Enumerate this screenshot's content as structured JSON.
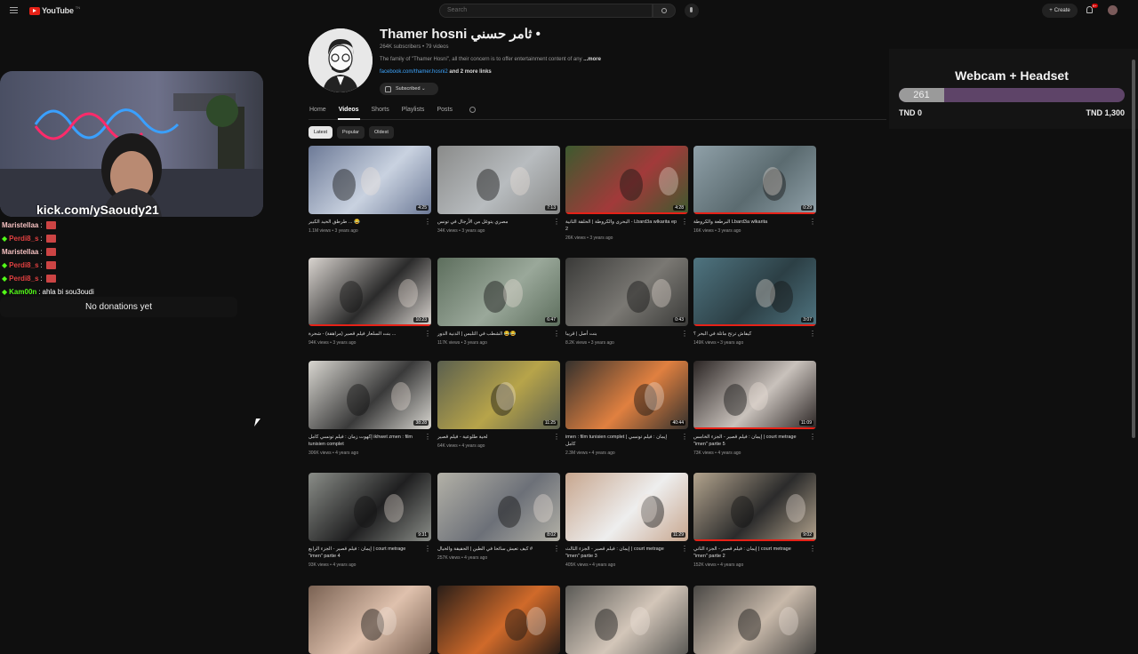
{
  "app": {
    "logo_text": "YouTube",
    "logo_sup": "TN"
  },
  "topbar": {
    "search_placeholder": "Search",
    "create_label": "Create",
    "notif_count": "9+"
  },
  "channel": {
    "name": "Thamer hosni ثامر حسني •",
    "meta": "264K subscribers • 79 videos",
    "desc": "The family of \"Thamer Hosni\", all their concern is to offer entertainment content of any",
    "more": "...more",
    "link": "facebook.com/thamer.hosni2",
    "more_links": "and 2 more links",
    "subscribed": "Subscribed"
  },
  "tabs": [
    {
      "label": "Home"
    },
    {
      "label": "Videos"
    },
    {
      "label": "Shorts"
    },
    {
      "label": "Playlists"
    },
    {
      "label": "Posts"
    }
  ],
  "chips": [
    {
      "label": "Latest"
    },
    {
      "label": "Popular"
    },
    {
      "label": "Oldest"
    }
  ],
  "videos": [
    {
      "title": "طرطق الحيد الكبير ... 😂 ",
      "meta": "1.1M views • 3 years ago",
      "duration": "4:25",
      "progress": 0.0
    },
    {
      "title": "مصري يتوغل من الأرجال في تونس",
      "meta": "34K views • 3 years ago",
      "duration": "7:13",
      "progress": 0.0
    },
    {
      "title": "البحرى والكروطة | الحلقة الثانية - Lbard3a wlkarita ep 2",
      "meta": "26K views • 3 years ago",
      "duration": "4:28",
      "progress": 1.0
    },
    {
      "title": "البرطعة والكروطة Lbard3a wlkarita",
      "meta": "16K views • 3 years ago",
      "duration": "0:29",
      "progress": 1.0
    },
    {
      "title": "بنت السلعار فيلم قصير (مراهقة) - شحرة ...",
      "meta": "94K views • 3 years ago",
      "duration": "10:23",
      "progress": 1.0
    },
    {
      "title": "الشطب في التلبس | الدنية الدور 😂😂",
      "meta": "117K views • 3 years ago",
      "duration": "6:47",
      "progress": 0.0
    },
    {
      "title": "بنت أصل | قريبا",
      "meta": "8.2K views • 3 years ago",
      "duration": "0:43",
      "progress": 0.0
    },
    {
      "title": "كيفاش ترتح ماتلة في البحر ؟",
      "meta": "149K views • 3 years ago",
      "duration": "3:07",
      "progress": 1.0
    },
    {
      "title": "إكهوت زمان : فيلم تونسي كامل ikhwet zmen : film tunisien complet",
      "meta": "306K views • 4 years ago",
      "duration": "38:28",
      "progress": 0.0
    },
    {
      "title": "لحية طلوعية - فيلم قصير",
      "meta": "64K views • 4 years ago",
      "duration": "11:25",
      "progress": 0.0
    },
    {
      "title": "imen : film tunisien complet | إيمان : فيلم تونسي كامل",
      "meta": "2.3M views • 4 years ago",
      "duration": "40:44",
      "progress": 0.0
    },
    {
      "title": "إيمان : فيلم قصير - الجزء الخامس | court metrage \"imen\" partie 5",
      "meta": "73K views • 4 years ago",
      "duration": "11:09",
      "progress": 1.0
    },
    {
      "title": "إيمان : فيلم قصير - الجزء الرابع | court metrage \"imen\" partie 4",
      "meta": "93K views • 4 years ago",
      "duration": "9:31",
      "progress": 0.0
    },
    {
      "title": "كيف تعيش سائحا في الطين | الحقيقة والخيال #",
      "meta": "257K views • 4 years ago",
      "duration": "8:02",
      "progress": 0.0
    },
    {
      "title": "إيمان : فيلم قصير - الجزء الثالث | court metrage \"imen\" partie 3",
      "meta": "405K views • 4 years ago",
      "duration": "11:29",
      "progress": 0.0
    },
    {
      "title": "إيمان : فيلم قصير - الجزء الثاني | court metrage \"imen\" partie 2",
      "meta": "152K views • 4 years ago",
      "duration": "9:02",
      "progress": 1.0
    },
    {
      "title": "",
      "meta": "",
      "duration": "",
      "progress": 0.0
    },
    {
      "title": "",
      "meta": "",
      "duration": "",
      "progress": 0.0
    },
    {
      "title": "",
      "meta": "",
      "duration": "",
      "progress": 0.0
    },
    {
      "title": "",
      "meta": "",
      "duration": "",
      "progress": 0.0
    }
  ],
  "overlay": {
    "kick_text": "kick.com/ySaoudy21",
    "chat": [
      {
        "user": "Maristellaa",
        "sep": ":",
        "text": "",
        "color": "#f4c0c0",
        "badge": false
      },
      {
        "user": "Perdi8_s",
        "sep": ":",
        "text": "",
        "color": "#e04040",
        "badge": true
      },
      {
        "user": "Maristellaa",
        "sep": ":",
        "text": "",
        "color": "#f4c0c0",
        "badge": false
      },
      {
        "user": "Perdi8_s",
        "sep": ":",
        "text": "",
        "color": "#e04040",
        "badge": true
      },
      {
        "user": "Perdi8_s",
        "sep": ":",
        "text": "",
        "color": "#e04040",
        "badge": true
      },
      {
        "user": "Kam00n",
        "sep": ":",
        "text": "ahla bi sou3oudi",
        "color": "#53fc18",
        "badge": true
      }
    ],
    "donations": "No donations yet"
  },
  "goal": {
    "title": "Webcam + Headset",
    "current": "261",
    "fill": 0.2,
    "min_label": "TND 0",
    "max_label": "TND 1,300"
  }
}
